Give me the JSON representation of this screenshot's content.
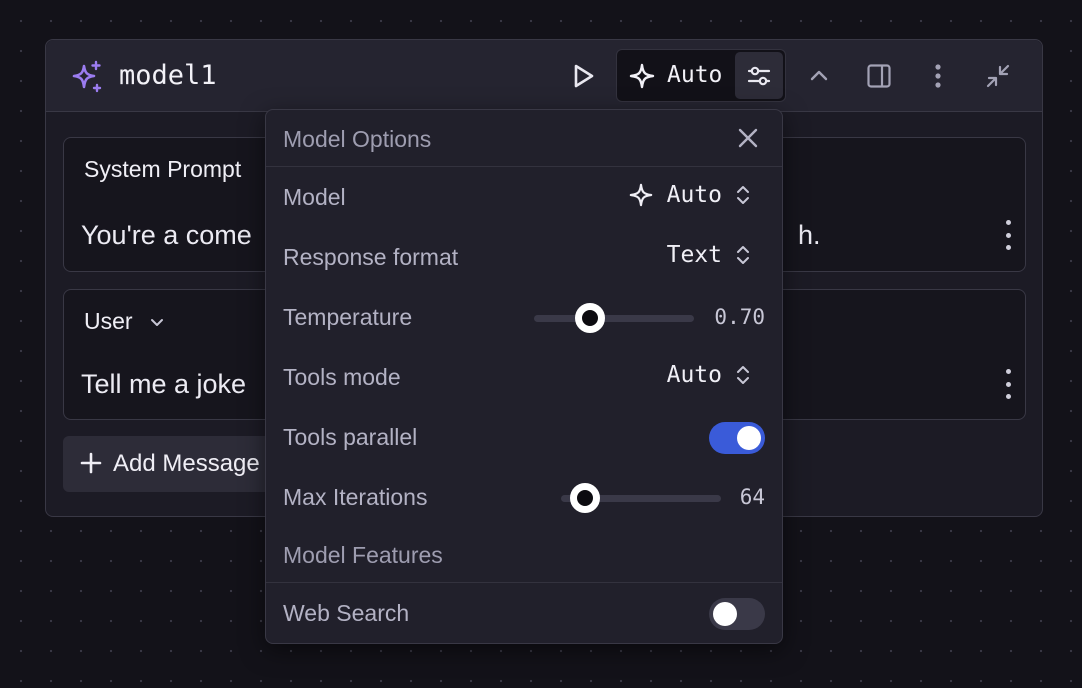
{
  "node": {
    "title": "model1",
    "model_pill_label": "Auto",
    "icons": [
      "sparkles-icon",
      "play-icon",
      "sparkle-icon",
      "sliders-icon",
      "chevron-up-icon",
      "panel-icon",
      "more-vertical-icon",
      "collapse-icon"
    ]
  },
  "messages": [
    {
      "role": "System Prompt",
      "text_start": "You're a come",
      "text_end": "h."
    },
    {
      "role": "User",
      "text_start": "Tell me a joke",
      "text_end": ""
    }
  ],
  "add_message_label": "Add Message",
  "popup": {
    "title": "Model Options",
    "rows": {
      "model": {
        "label": "Model",
        "value": "Auto"
      },
      "response_format": {
        "label": "Response format",
        "value": "Text"
      },
      "temperature": {
        "label": "Temperature",
        "value": "0.70",
        "fraction": 0.35
      },
      "tools_mode": {
        "label": "Tools mode",
        "value": "Auto"
      },
      "tools_parallel": {
        "label": "Tools parallel",
        "on": true
      },
      "max_iterations": {
        "label": "Max Iterations",
        "value": "64",
        "fraction": 0.15
      },
      "features_heading": "Model Features",
      "web_search": {
        "label": "Web Search",
        "on": false
      }
    }
  },
  "colors": {
    "accent": "#3a5bd9",
    "sparkle": "#9b7cf0"
  }
}
